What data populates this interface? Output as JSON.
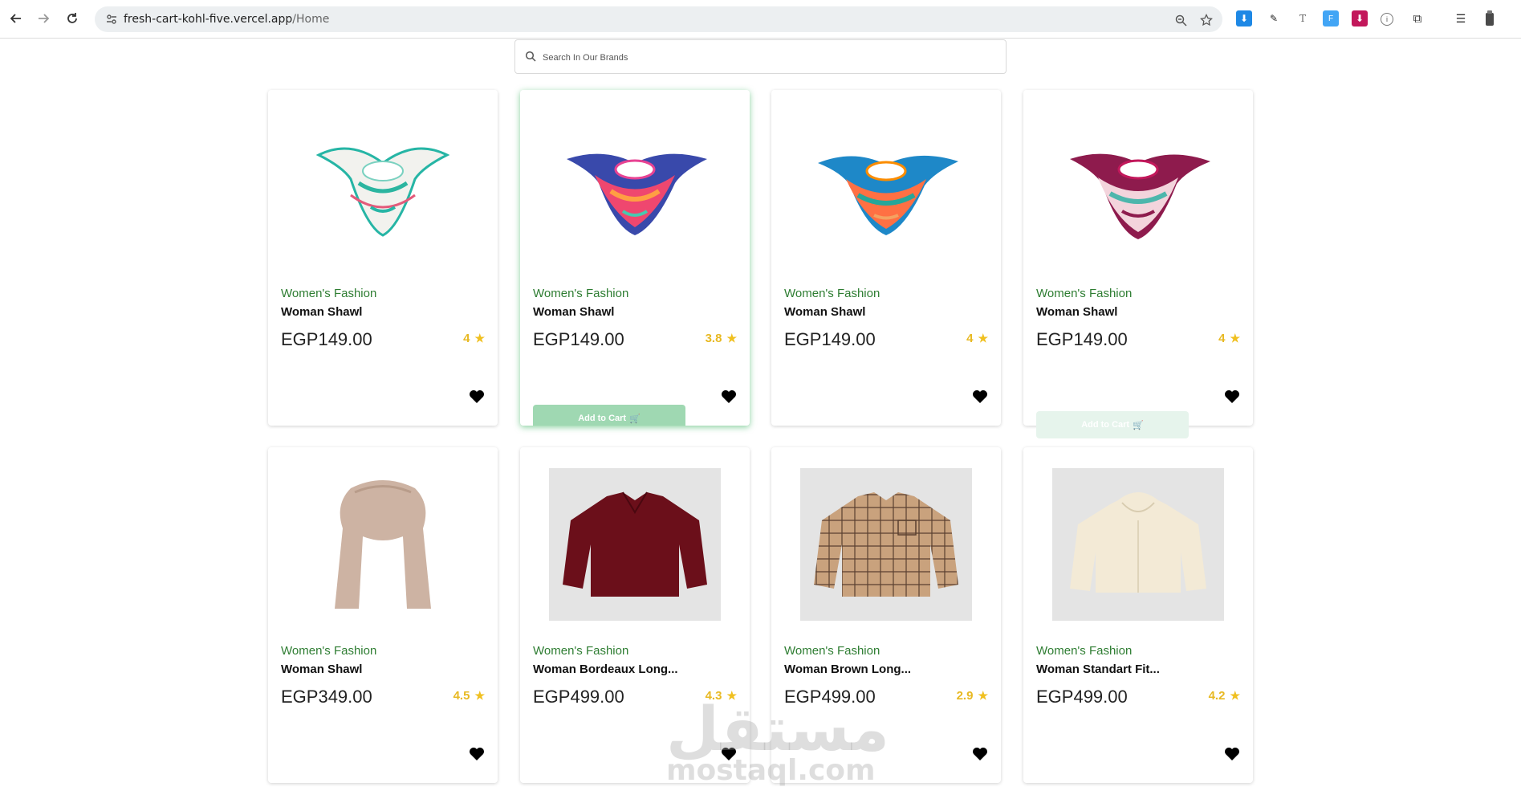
{
  "browser": {
    "url_host": "fresh-cart-kohl-five.vercel.app",
    "url_path": "/Home"
  },
  "search": {
    "placeholder": "Search In Our Brands"
  },
  "products": [
    {
      "category": "Women's Fashion",
      "title": "Woman Shawl",
      "price": "EGP149.00",
      "rating": "4",
      "image": "shawl-teal-white",
      "add_to_cart": ""
    },
    {
      "category": "Women's Fashion",
      "title": "Woman Shawl",
      "price": "EGP149.00",
      "rating": "3.8",
      "image": "shawl-pink-blue",
      "add_to_cart": "Add to Cart"
    },
    {
      "category": "Women's Fashion",
      "title": "Woman Shawl",
      "price": "EGP149.00",
      "rating": "4",
      "image": "shawl-orange-teal",
      "add_to_cart": ""
    },
    {
      "category": "Women's Fashion",
      "title": "Woman Shawl",
      "price": "EGP149.00",
      "rating": "4",
      "image": "shawl-purple-pink",
      "add_to_cart": "Add to Cart"
    },
    {
      "category": "Women's Fashion",
      "title": "Woman Shawl",
      "price": "EGP349.00",
      "rating": "4.5",
      "image": "scarf-beige",
      "add_to_cart": ""
    },
    {
      "category": "Women's Fashion",
      "title": "Woman Bordeaux Long...",
      "price": "EGP499.00",
      "rating": "4.3",
      "image": "shirt-bordeaux",
      "add_to_cart": ""
    },
    {
      "category": "Women's Fashion",
      "title": "Woman Brown Long...",
      "price": "EGP499.00",
      "rating": "2.9",
      "image": "shirt-brown-plaid",
      "add_to_cart": ""
    },
    {
      "category": "Women's Fashion",
      "title": "Woman Standart Fit...",
      "price": "EGP499.00",
      "rating": "4.2",
      "image": "hoodie-cream",
      "add_to_cart": ""
    }
  ],
  "watermark": {
    "arabic": "مستقل",
    "latin": "mostaql.com"
  },
  "colors": {
    "category_green": "#2e7d32",
    "rating_gold": "#e8b923",
    "add_to_cart_green": "#9fd8b2"
  }
}
